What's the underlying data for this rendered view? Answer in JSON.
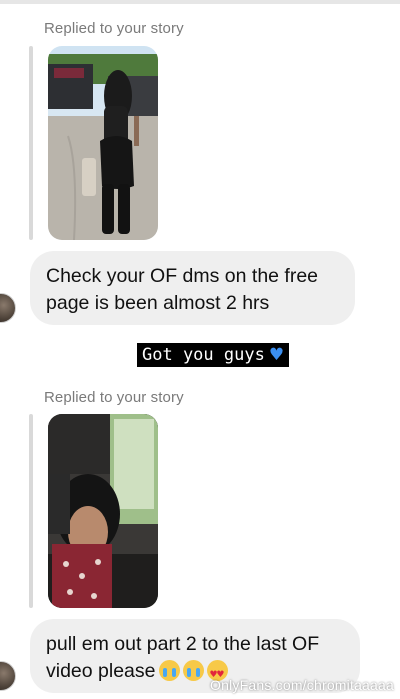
{
  "thread": {
    "messages": [
      {
        "reply_label": "Replied to your story",
        "text": "Check your OF dms on the free page is been almost 2 hrs"
      },
      {
        "reply_label": "Replied to your story",
        "text": "pull em out part 2 to the last OF video please"
      }
    ]
  },
  "overlay_caption": "Got you guys",
  "watermark": "OnlyFans.com/chromitaaaaa",
  "colors": {
    "bubble": "#efefef",
    "reply_bar": "#d9d9d9",
    "reply_label": "#7a7a7a",
    "heart": "#3b8ff0"
  },
  "icons": {
    "caption_heart": "blue-heart-icon",
    "emojis": [
      "crying-face-icon",
      "crying-face-icon",
      "heart-eyes-face-icon"
    ]
  }
}
